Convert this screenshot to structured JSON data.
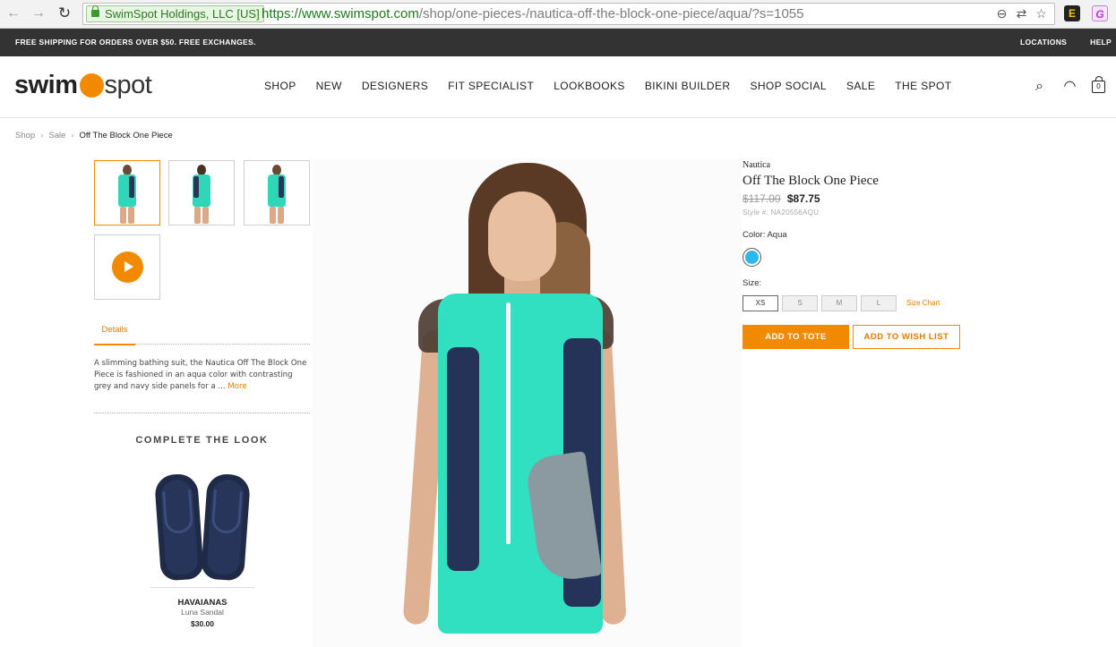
{
  "browser": {
    "ev_label": "SwimSpot Holdings, LLC [US]",
    "url_host": "https://www.swimspot.com",
    "url_path": "/shop/one-pieces-/nautica-off-the-block-one-piece/aqua/?s=1055"
  },
  "topbar": {
    "promo": "FREE SHIPPING FOR ORDERS OVER $50. FREE EXCHANGES.",
    "locations": "LOCATIONS",
    "help": "HELP"
  },
  "header": {
    "logo_left": "swim",
    "logo_right": "spot",
    "nav": [
      "SHOP",
      "NEW",
      "DESIGNERS",
      "FIT SPECIALIST",
      "LOOKBOOKS",
      "BIKINI BUILDER",
      "SHOP SOCIAL",
      "SALE",
      "THE SPOT"
    ],
    "bag_count": "0"
  },
  "breadcrumb": [
    "Shop",
    "Sale",
    "Off The Block One Piece"
  ],
  "details": {
    "tab": "Details",
    "description": "A slimming bathing suit, the Nautica Off The Block One Piece is fashioned in an aqua color with contrasting grey and navy side panels for a ...",
    "more": "More"
  },
  "complete_the_look": {
    "heading": "COMPLETE THE LOOK",
    "brand": "HAVAIANAS",
    "name": "Luna Sandal",
    "price": "$30.00"
  },
  "product": {
    "brand": "Nautica",
    "title": "Off The Block One Piece",
    "old_price": "$117.00",
    "price": "$87.75",
    "style": "Style #: NA20556AQU",
    "color_label": "Color: Aqua",
    "swatch_color": "#2bb9ec",
    "size_label": "Size:",
    "sizes": [
      "XS",
      "S",
      "M",
      "L"
    ],
    "size_chart": "Size Chart",
    "add_to_tote": "ADD TO TOTE",
    "add_to_wishlist": "ADD TO WISH LIST"
  },
  "colors": {
    "accent": "#f28a00",
    "topbar": "#333333"
  }
}
